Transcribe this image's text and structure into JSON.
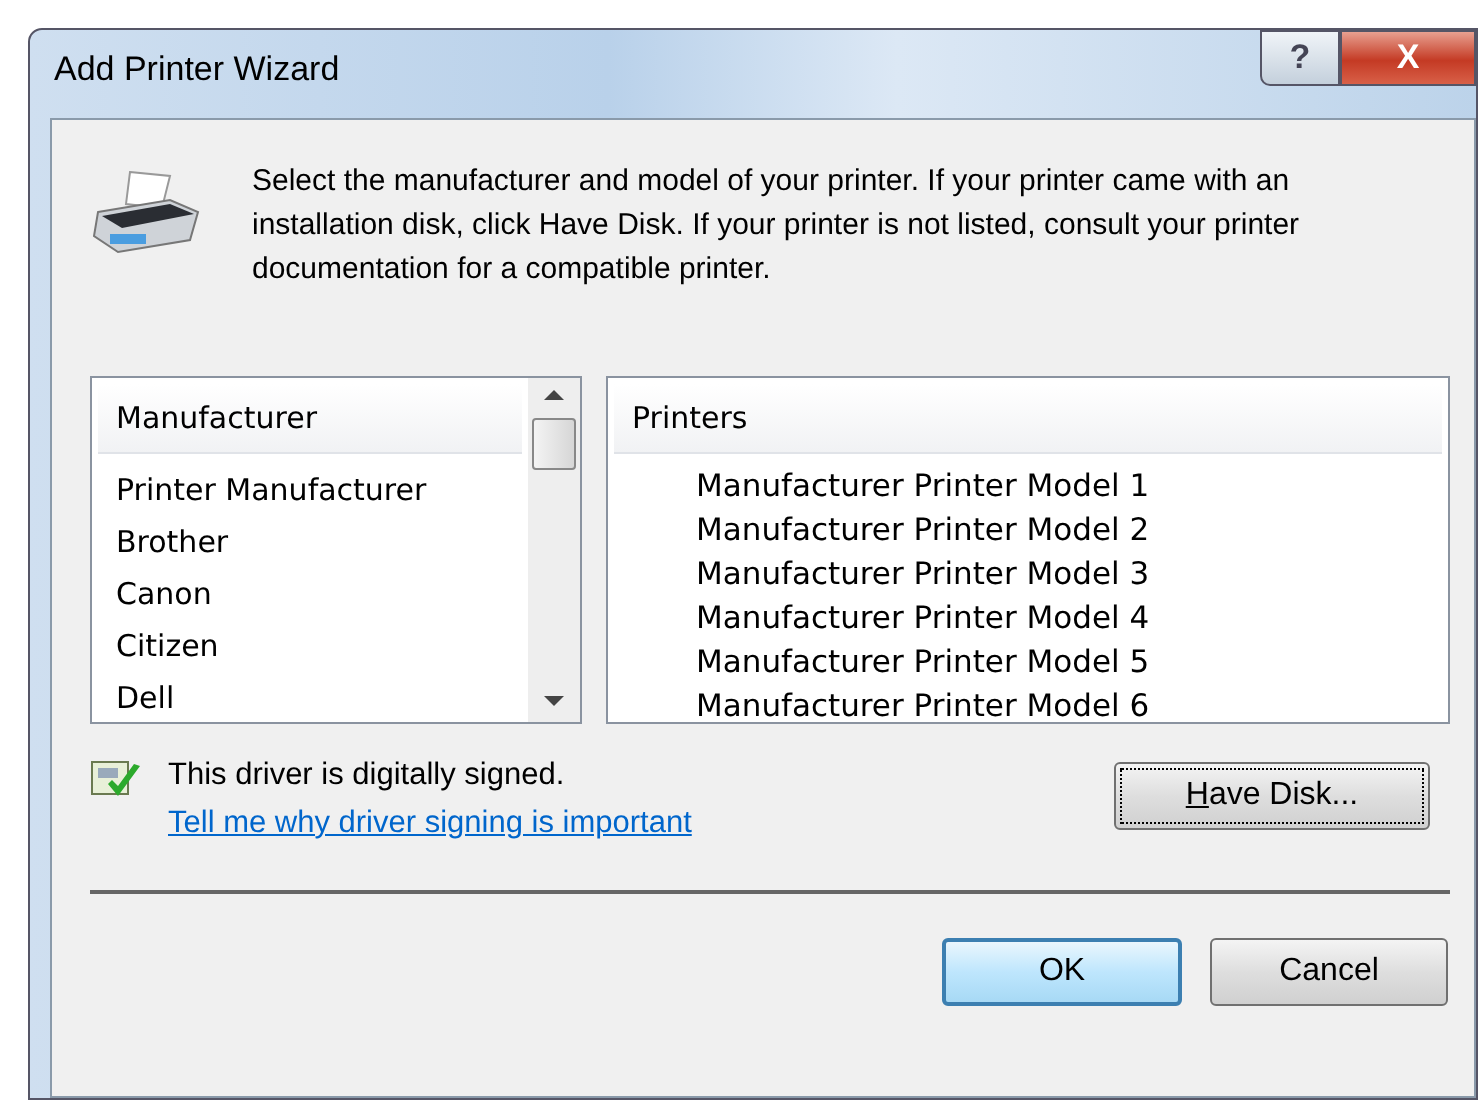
{
  "window": {
    "title": "Add Printer Wizard"
  },
  "title_buttons": [
    {
      "label": "?",
      "kind": "help"
    },
    {
      "label": "X",
      "kind": "close"
    }
  ],
  "instructions": "Select the manufacturer and model of your printer. If your printer came with an installation disk, click Have Disk. If your printer is not listed, consult your printer documentation for a compatible printer.",
  "manufacturer_list": {
    "header": "Manufacturer",
    "items": [
      {
        "label": "Printer Manufacturer",
        "selected": false
      },
      {
        "label": "Brother",
        "selected": false
      },
      {
        "label": "Canon",
        "selected": false
      },
      {
        "label": "Citizen",
        "selected": false
      },
      {
        "label": "Dell",
        "selected": false
      }
    ]
  },
  "printer_list": {
    "header": "Printers",
    "items": [
      {
        "label": "Manufacturer Printer Model 1",
        "selected": false
      },
      {
        "label": "Manufacturer Printer Model 2",
        "selected": false
      },
      {
        "label": "Manufacturer Printer Model 3",
        "selected": false
      },
      {
        "label": "Manufacturer Printer Model 4",
        "selected": false
      },
      {
        "label": "Manufacturer Printer Model 5",
        "selected": false
      },
      {
        "label": "Manufacturer Printer Model 6",
        "selected": false
      }
    ]
  },
  "signing": {
    "text": "This driver is digitally signed.",
    "link": "Tell me why driver signing is important"
  },
  "have_disk_button": "Have Disk...",
  "buttons": [
    {
      "label": "OK",
      "kind": "default"
    },
    {
      "label": "Cancel",
      "kind": "normal"
    }
  ]
}
